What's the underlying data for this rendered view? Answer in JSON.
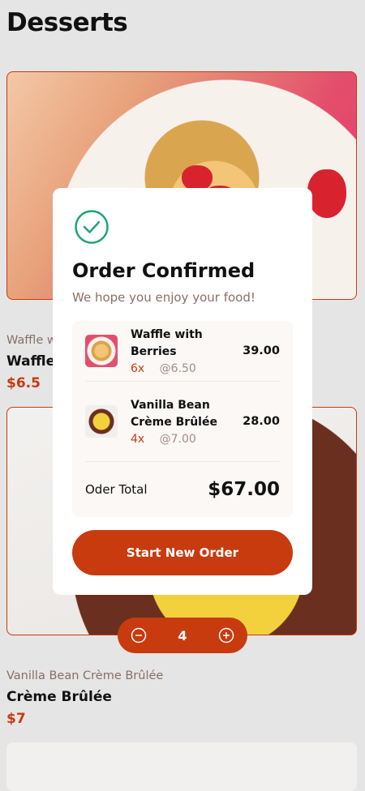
{
  "page": {
    "title": "Desserts"
  },
  "products": [
    {
      "category": "Waffle with Berries",
      "name": "Waffle with Berries",
      "price": "$6.5"
    },
    {
      "category": "Vanilla Bean Crème Brûlée",
      "name": "Crème Brûlée",
      "price": "$7"
    }
  ],
  "visible_partial_labels": {
    "category_1": "Waffle w",
    "name_1": "Waffle"
  },
  "quantity_stepper": {
    "value": "4",
    "minus_icon": "minus-circle-icon",
    "plus_icon": "plus-circle-icon"
  },
  "modal": {
    "icon": "check-circle-icon",
    "title": "Order Confirmed",
    "subtitle": "We hope you enjoy your food!",
    "items": [
      {
        "name": "Waffle with Berries",
        "qty": "6x",
        "unit_price": "@6.50",
        "total": "39.00"
      },
      {
        "name": "Vanilla Bean Crème Brûlée",
        "qty": "4x",
        "unit_price": "@7.00",
        "total": "28.00"
      }
    ],
    "total_label": "Oder Total",
    "total_value": "$67.00",
    "button_label": "Start New Order"
  },
  "colors": {
    "accent": "#c73b0f",
    "background": "#e6e5e5",
    "success": "#1ea475"
  }
}
